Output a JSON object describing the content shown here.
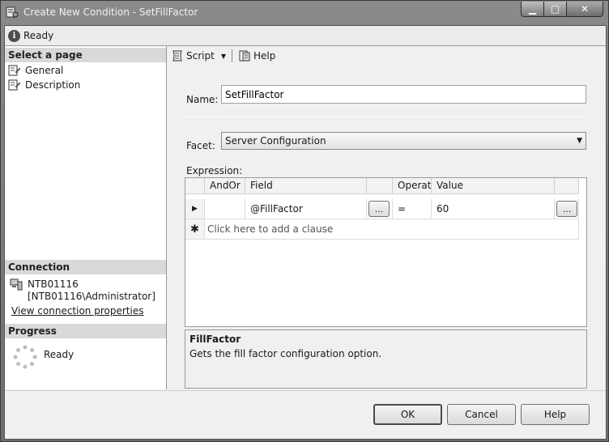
{
  "window": {
    "title": "Create New Condition - SetFillFactor",
    "buttons": {
      "minimize": "▁",
      "maximize": "□",
      "close": "✕"
    }
  },
  "status": {
    "text": "Ready",
    "icon": "info-icon"
  },
  "left_pane": {
    "select_page_header": "Select a page",
    "pages": [
      {
        "label": "General",
        "icon": "page-wrench-icon"
      },
      {
        "label": "Description",
        "icon": "page-wrench-icon"
      }
    ],
    "connection_header": "Connection",
    "connection": {
      "server": "NTB01116",
      "user": "[NTB01116\\Administrator]",
      "link": "View connection properties"
    },
    "progress_header": "Progress",
    "progress_text": "Ready"
  },
  "toolbar": {
    "script_label": "Script",
    "help_label": "Help"
  },
  "form": {
    "name_label": "Name:",
    "name_value": "SetFillFactor",
    "facet_label": "Facet:",
    "facet_value": "Server Configuration",
    "expression_label": "Expression:"
  },
  "grid": {
    "columns": [
      "AndOr",
      "Field",
      "Operato",
      "Value"
    ],
    "rows": [
      {
        "andor": "",
        "field": "@FillFactor",
        "operator": "=",
        "value": "60"
      }
    ],
    "add_clause": "Click here to add a clause",
    "ellipsis": "..."
  },
  "description": {
    "title": "FillFactor",
    "text": "Gets the fill factor configuration option."
  },
  "buttons": {
    "ok": "OK",
    "cancel": "Cancel",
    "help": "Help"
  }
}
